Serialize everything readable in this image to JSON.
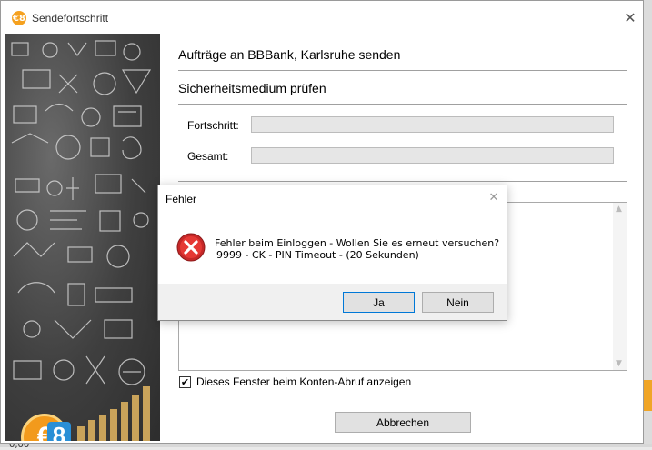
{
  "background": {
    "bottom_text": "0,00"
  },
  "window": {
    "title": "Sendefortschritt",
    "logo_text": "€8",
    "close_icon": "close-icon"
  },
  "panel": {
    "heading": "Aufträge an BBBank, Karlsruhe senden",
    "subheading": "Sicherheitsmedium prüfen",
    "progress_label": "Fortschritt:",
    "progress_value": 0,
    "total_label": "Gesamt:",
    "total_value": 0,
    "checkbox_label": "Dieses Fenster beim Konten-Abruf anzeigen",
    "checkbox_checked": true,
    "cancel_label": "Abbrechen"
  },
  "dialog": {
    "title": "Fehler",
    "message_line1": "Fehler beim Einloggen - Wollen Sie es erneut versuchen?",
    "message_line2": "9999 - CK - PIN Timeout - (20 Sekunden)",
    "icon": "error-icon",
    "yes_label": "Ja",
    "no_label": "Nein"
  },
  "colors": {
    "accent_orange": "#f5a11f",
    "error_red": "#c62828"
  }
}
